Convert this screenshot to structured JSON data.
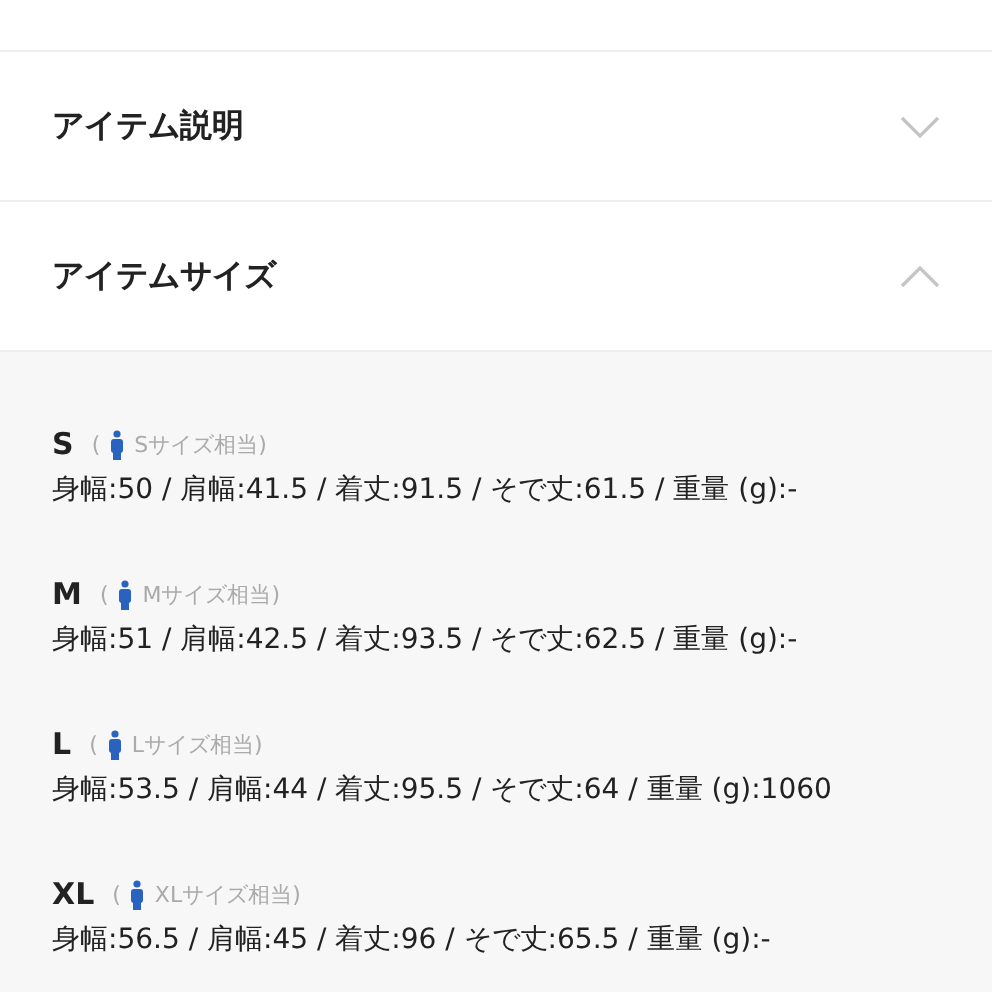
{
  "sections": [
    {
      "title": "アイテム説明",
      "expanded": false
    },
    {
      "title": "アイテムサイズ",
      "expanded": true
    }
  ],
  "sizes": [
    {
      "label": "S",
      "open": "(",
      "equivalent": "Sサイズ相当)",
      "measurements": "身幅:50 / 肩幅:41.5 / 着丈:91.5 / そで丈:61.5 / 重量 (g):-"
    },
    {
      "label": "M",
      "open": "(",
      "equivalent": "Mサイズ相当)",
      "measurements": "身幅:51 / 肩幅:42.5 / 着丈:93.5 / そで丈:62.5 / 重量 (g):-"
    },
    {
      "label": "L",
      "open": "(",
      "equivalent": "Lサイズ相当)",
      "measurements": "身幅:53.5 / 肩幅:44 / 着丈:95.5 / そで丈:64 / 重量 (g):1060"
    },
    {
      "label": "XL",
      "open": "(",
      "equivalent": "XLサイズ相当)",
      "measurements": "身幅:56.5 / 肩幅:45 / 着丈:96 / そで丈:65.5 / 重量 (g):-"
    }
  ]
}
